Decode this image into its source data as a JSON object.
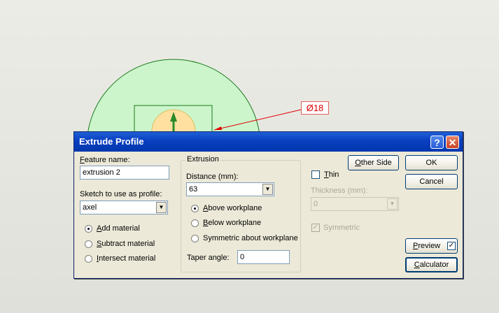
{
  "canvas": {
    "dimension_text": "Ø18"
  },
  "dialog": {
    "title": "Extrude Profile",
    "help_icon": "?",
    "close_icon": "✕",
    "feature_name_label": "Feature name:",
    "feature_name_value": "extrusion 2",
    "sketch_label": "Sketch to use as profile:",
    "sketch_value": "axel",
    "material_options": [
      {
        "label": "Add material",
        "selected": true
      },
      {
        "label": "Subtract material",
        "selected": false
      },
      {
        "label": "Intersect material",
        "selected": false
      }
    ],
    "extrusion": {
      "group_title": "Extrusion",
      "distance_label": "Distance (mm):",
      "distance_value": "63",
      "placement_options": [
        {
          "label": "Above workplane",
          "selected": true
        },
        {
          "label": "Below workplane",
          "selected": false
        },
        {
          "label": "Symmetric about workplane",
          "selected": false
        }
      ],
      "taper_label": "Taper angle:",
      "taper_value": "0"
    },
    "other_side_label": "Other Side",
    "thin_label": "Thin",
    "thickness_label": "Thickness (mm):",
    "thickness_value": "0",
    "symmetric_label": "Symmetric",
    "ok_label": "OK",
    "cancel_label": "Cancel",
    "preview_label": "Preview",
    "preview_checked": true,
    "calculator_label": "Calculator"
  },
  "colors": {
    "title_bar": "#0a3fc0",
    "dialog_bg": "#ece9d8",
    "circle_fill": "#ccf5cc",
    "circle_stroke": "#1a7a1a",
    "inner_fill": "#ffe0a0",
    "dimension": "#e00000"
  }
}
